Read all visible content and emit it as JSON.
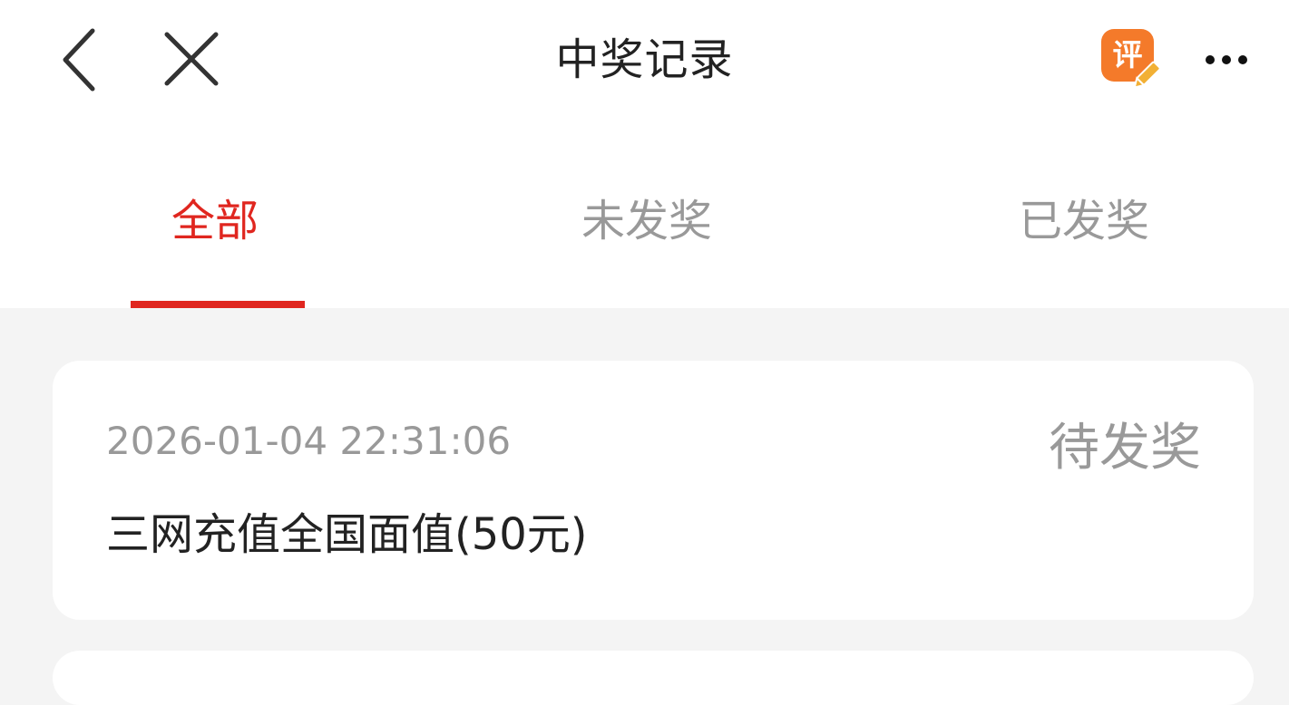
{
  "header": {
    "title": "中奖记录",
    "icons": {
      "back": "chevron-left-icon",
      "close": "close-icon",
      "review": "review-icon",
      "more": "more-dots-icon"
    },
    "review_label": "评",
    "colors": {
      "review_badge": "#f47a2a",
      "review_pencil": "#f2b035"
    }
  },
  "tabs": {
    "items": [
      {
        "label": "全部",
        "active": true
      },
      {
        "label": "未发奖",
        "active": false
      },
      {
        "label": "已发奖",
        "active": false
      }
    ],
    "active_color": "#e0261f",
    "inactive_color": "#999999"
  },
  "records": [
    {
      "time": "2026-01-04 22:31:06",
      "status": "待发奖",
      "prize": "三网充值全国面值(50元)"
    }
  ]
}
